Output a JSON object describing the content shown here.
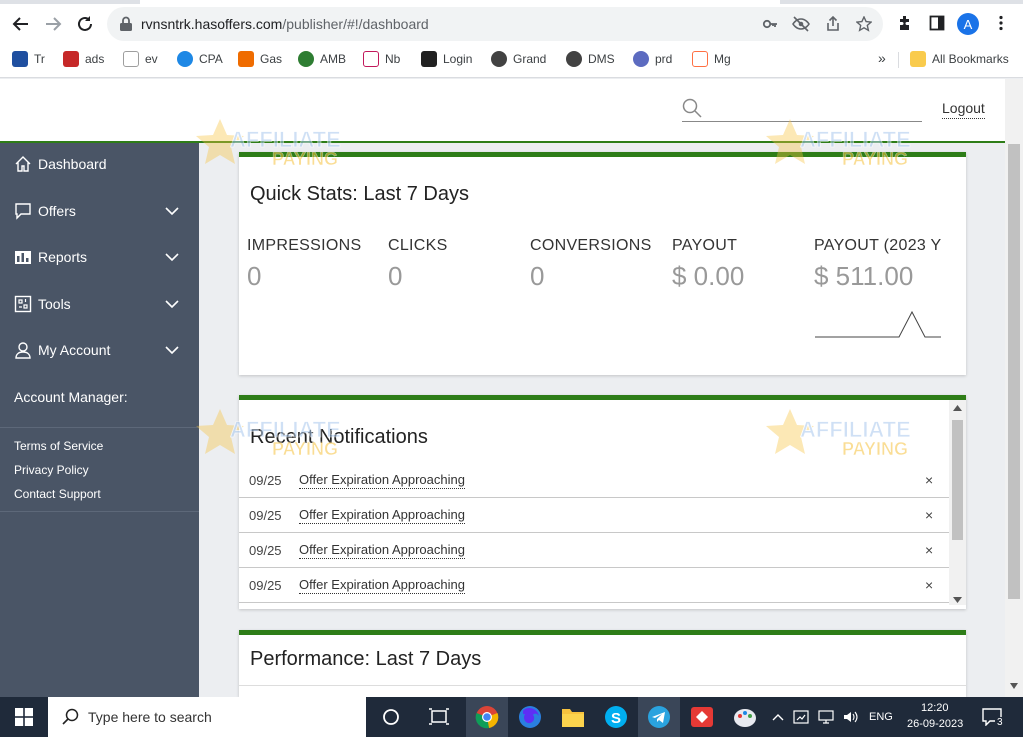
{
  "browser": {
    "url_host": "rvnsntrk.hasoffers.com",
    "url_path": "/publisher/#!/dashboard",
    "avatar_letter": "A",
    "bookmarks": [
      {
        "label": "Tr",
        "color": "#1f4fa0"
      },
      {
        "label": "ads",
        "color": "#c62828"
      },
      {
        "label": "ev",
        "color": "#9e9e9e"
      },
      {
        "label": "CPA",
        "color": "#1e88e5"
      },
      {
        "label": "Gas",
        "color": "#ef6c00"
      },
      {
        "label": "AMB",
        "color": "#2e7d32"
      },
      {
        "label": "Nb",
        "color": "#c2185b"
      },
      {
        "label": "Login",
        "color": "#212121"
      },
      {
        "label": "Grand",
        "color": "#424242"
      },
      {
        "label": "DMS",
        "color": "#424242"
      },
      {
        "label": "prd",
        "color": "#5c6bc0"
      },
      {
        "label": "Mg",
        "color": "#ff7043"
      }
    ],
    "all_bookmarks": "All Bookmarks"
  },
  "header": {
    "logout_label": "Logout",
    "search_placeholder": ""
  },
  "sidebar": {
    "items": [
      {
        "label": "Dashboard",
        "icon": "home-icon"
      },
      {
        "label": "Offers",
        "icon": "chat-icon"
      },
      {
        "label": "Reports",
        "icon": "bar-chart-icon"
      },
      {
        "label": "Tools",
        "icon": "tools-icon"
      },
      {
        "label": "My Account",
        "icon": "user-icon"
      }
    ],
    "account_manager": "Account Manager:",
    "links": [
      "Terms of Service",
      "Privacy Policy",
      "Contact Support"
    ]
  },
  "quick_stats": {
    "title": "Quick Stats: Last 7 Days",
    "stats": [
      {
        "label": "IMPRESSIONS",
        "value": "0"
      },
      {
        "label": "CLICKS",
        "value": "0"
      },
      {
        "label": "CONVERSIONS",
        "value": "0"
      },
      {
        "label": "PAYOUT",
        "value": "$ 0.00"
      },
      {
        "label": "PAYOUT (2023 Y",
        "value": "$ 511.00"
      }
    ]
  },
  "notifications": {
    "title": "Recent Notifications",
    "rows": [
      {
        "date": "09/25",
        "message": "Offer Expiration Approaching"
      },
      {
        "date": "09/25",
        "message": "Offer Expiration Approaching"
      },
      {
        "date": "09/25",
        "message": "Offer Expiration Approaching"
      },
      {
        "date": "09/25",
        "message": "Offer Expiration Approaching"
      }
    ],
    "dismiss": "×"
  },
  "performance": {
    "title": "Performance: Last 7 Days"
  },
  "watermark": {
    "line1": "AFFILIATE",
    "line2": "PAYING"
  },
  "taskbar": {
    "search_placeholder": "Type here to search",
    "language": "ENG",
    "time": "12:20",
    "date": "26-09-2023",
    "notification_count": "3"
  }
}
